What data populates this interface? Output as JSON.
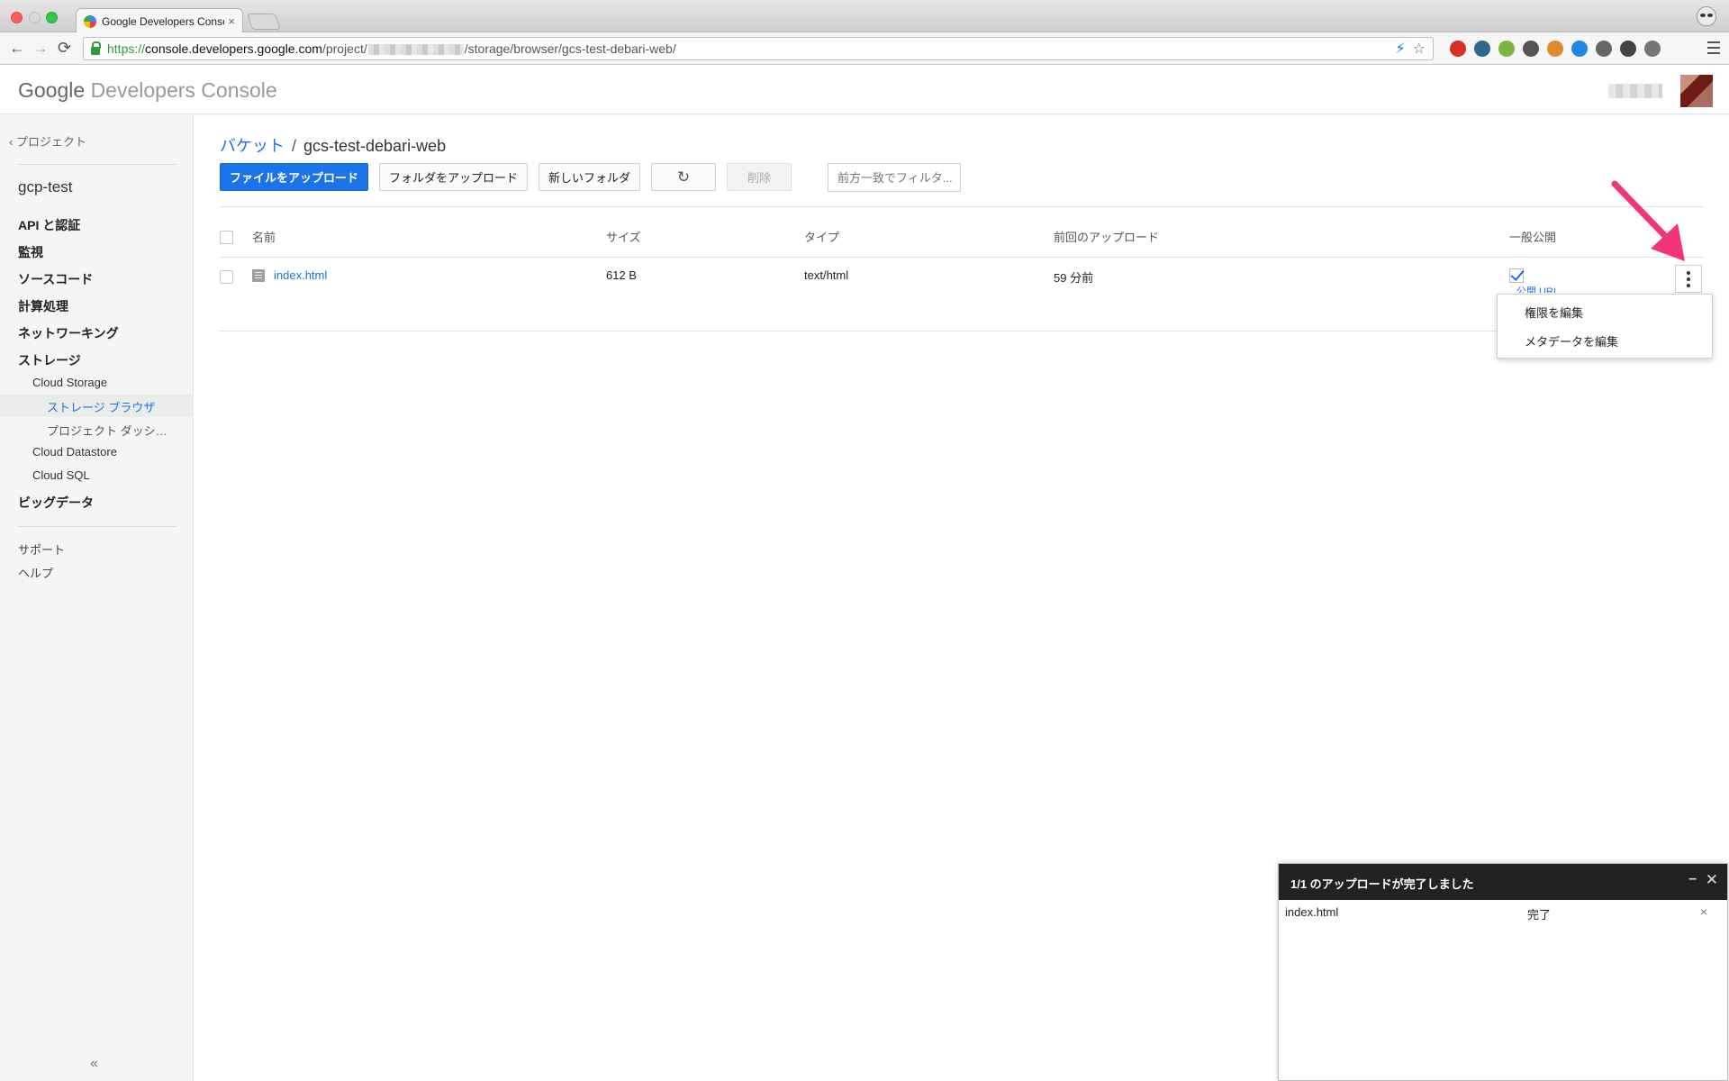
{
  "browser": {
    "tab_title": "Google Developers Console",
    "tab_close": "×",
    "url_scheme": "https://",
    "url_host": "console.developers.google.com",
    "url_path_start": "/project/",
    "url_path_end": "/storage/browser/gcs-test-debari-web/",
    "back_icon": "←",
    "forward_icon": "→",
    "reload_icon": "⟳",
    "extension_colors": [
      "#d93025",
      "#2d6a8a",
      "#7cb342",
      "#555555",
      "#e08a2c",
      "#1e88e5",
      "#666666",
      "#444444",
      "#757575"
    ]
  },
  "header": {
    "logo_google": "Google",
    "logo_product": "Developers Console"
  },
  "sidebar": {
    "back_label": "‹ プロジェクト",
    "project_name": "gcp-test",
    "items": [
      {
        "label": "API と認証"
      },
      {
        "label": "監視"
      },
      {
        "label": "ソースコード"
      },
      {
        "label": "計算処理"
      },
      {
        "label": "ネットワーキング"
      },
      {
        "label": "ストレージ"
      }
    ],
    "storage_children": [
      {
        "label": "Cloud Storage"
      },
      {
        "label": "Cloud Datastore"
      },
      {
        "label": "Cloud SQL"
      }
    ],
    "cloud_storage_children": [
      {
        "label": "ストレージ ブラウザ",
        "active": true
      },
      {
        "label": "プロジェクト ダッシ…"
      }
    ],
    "bigdata_label": "ビッグデータ",
    "support_label": "サポート",
    "help_label": "ヘルプ",
    "collapse_label": "«"
  },
  "breadcrumb": {
    "parent": "バケット",
    "separator": "/",
    "current": "gcs-test-debari-web"
  },
  "toolbar": {
    "upload_files": "ファイルをアップロード",
    "upload_folder": "フォルダをアップロード",
    "new_folder": "新しいフォルダ",
    "refresh_icon": "↻",
    "delete": "削除",
    "filter_placeholder": "前方一致でフィルタ..."
  },
  "table": {
    "columns": [
      "名前",
      "サイズ",
      "タイプ",
      "前回のアップロード",
      "一般公開"
    ],
    "rows": [
      {
        "name": "index.html",
        "size": "612 B",
        "type": "text/html",
        "last_upload": "59 分前",
        "public": true,
        "public_link": "公開 URL"
      }
    ]
  },
  "row_menu": {
    "items": [
      "権限を編集",
      "メタデータを編集"
    ]
  },
  "upload_panel": {
    "title": "1/1 のアップロードが完了しました",
    "minimize": "–",
    "close": "✕",
    "files": [
      {
        "name": "index.html",
        "status": "完了",
        "remove": "×"
      }
    ]
  },
  "colors": {
    "accent": "#1a73e8",
    "annotation_arrow": "#f0357a"
  }
}
